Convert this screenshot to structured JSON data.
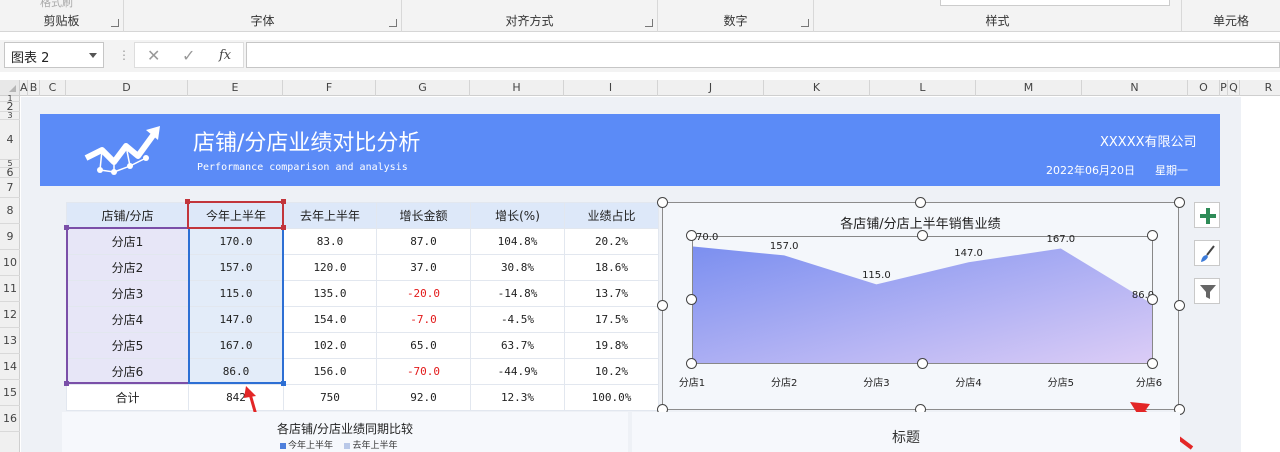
{
  "ribbon": {
    "groups": [
      {
        "label": "剪贴板"
      },
      {
        "label": "字体"
      },
      {
        "label": "对齐方式"
      },
      {
        "label": "数字"
      },
      {
        "label": "样式"
      },
      {
        "label": "单元格"
      }
    ]
  },
  "formula_bar": {
    "name_box": "图表 2",
    "cancel_glyph": "✕",
    "enter_glyph": "✓",
    "fx_glyph": "fx",
    "formula": ""
  },
  "columns": [
    "A",
    "B",
    "C",
    "D",
    "E",
    "F",
    "G",
    "H",
    "I",
    "J",
    "K",
    "L",
    "M",
    "N",
    "O",
    "P",
    "Q",
    "R"
  ],
  "rows": [
    "1",
    "2",
    "3",
    "4",
    "5",
    "6",
    "7",
    "8",
    "9",
    "10",
    "11",
    "12",
    "13",
    "14",
    "15",
    "16"
  ],
  "banner": {
    "title": "店铺/分店业绩对比分析",
    "subtitle": "Performance comparison and analysis",
    "company": "XXXXX有限公司",
    "date": "2022年06月20日",
    "weekday": "星期一",
    "color": "#5b8bf7"
  },
  "table": {
    "headers": [
      "店铺/分店",
      "今年上半年",
      "去年上半年",
      "增长金额",
      "增长(%)",
      "业绩占比"
    ],
    "rows": [
      {
        "store": "分店1",
        "current": "170.0",
        "last": "83.0",
        "growth": "87.0",
        "pct": "104.8%",
        "share": "20.2%"
      },
      {
        "store": "分店2",
        "current": "157.0",
        "last": "120.0",
        "growth": "37.0",
        "pct": "30.8%",
        "share": "18.6%"
      },
      {
        "store": "分店3",
        "current": "115.0",
        "last": "135.0",
        "growth": "-20.0",
        "pct": "-14.8%",
        "share": "13.7%"
      },
      {
        "store": "分店4",
        "current": "147.0",
        "last": "154.0",
        "growth": "-7.0",
        "pct": "-4.5%",
        "share": "17.5%"
      },
      {
        "store": "分店5",
        "current": "167.0",
        "last": "102.0",
        "growth": "65.0",
        "pct": "63.7%",
        "share": "19.8%"
      },
      {
        "store": "分店6",
        "current": "86.0",
        "last": "156.0",
        "growth": "-70.0",
        "pct": "-44.9%",
        "share": "10.2%"
      }
    ],
    "total": {
      "store": "合计",
      "current": "842",
      "last": "750",
      "growth": "92.0",
      "pct": "12.3%",
      "share": "100.0%"
    },
    "negative_color": "#e21a1a"
  },
  "chart_data": {
    "type": "area",
    "title": "各店铺/分店上半年销售业绩",
    "categories": [
      "分店1",
      "分店2",
      "分店3",
      "分店4",
      "分店5",
      "分店6"
    ],
    "values": [
      170.0,
      157.0,
      115.0,
      147.0,
      167.0,
      86.0
    ],
    "data_labels": [
      "170.0",
      "157.0",
      "115.0",
      "147.0",
      "167.0",
      "86.0"
    ],
    "ylim": [
      0,
      185
    ],
    "grid": false,
    "gradient": [
      "#7b8ff0",
      "#dccdf6"
    ]
  },
  "lower": {
    "left_title": "各店铺/分店业绩同期比较",
    "legend": [
      {
        "name": "今年上半年",
        "color": "#4e7fdc"
      },
      {
        "name": "去年上半年",
        "color": "#b9c8e8"
      }
    ],
    "right_title": "标题"
  }
}
